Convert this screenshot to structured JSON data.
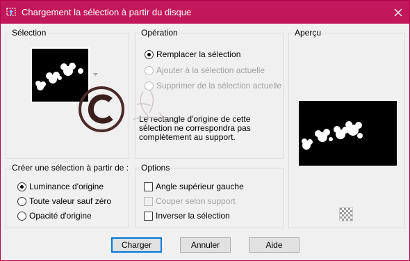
{
  "window": {
    "title": "Chargement la sélection à partir du disque",
    "accent_color": "#c2185b"
  },
  "icons": {
    "title": "selection-load-icon",
    "close": "close-icon",
    "transparency": "checkerboard-icon",
    "logo": "copyright-logo"
  },
  "selection": {
    "label": "Sélection"
  },
  "operation": {
    "label": "Opération",
    "options": [
      {
        "label": "Remplacer la sélection",
        "checked": true,
        "enabled": true
      },
      {
        "label": "Ajouter à la sélection actuelle",
        "checked": false,
        "enabled": false
      },
      {
        "label": "Supprimer de la sélection actuelle",
        "checked": false,
        "enabled": false
      }
    ],
    "note_lines": [
      "Le rectangle d'origine de cette",
      "sélection ne correspondra pas",
      "complètement au support."
    ]
  },
  "preview": {
    "label": "Aperçu"
  },
  "create": {
    "label": "Créer une sélection à partir de :",
    "options": [
      {
        "label": "Luminance d'origine",
        "checked": true
      },
      {
        "label": "Toute valeur sauf zéro",
        "checked": false
      },
      {
        "label": "Opacité d'origine",
        "checked": false
      }
    ]
  },
  "options": {
    "label": "Options",
    "items": [
      {
        "label": "Angle supérieur gauche",
        "checked": false,
        "enabled": true
      },
      {
        "label": "Couper selon support",
        "checked": false,
        "enabled": false
      },
      {
        "label": "Inverser la sélection",
        "checked": false,
        "enabled": true
      }
    ]
  },
  "buttons": {
    "ok": "Charger",
    "cancel": "Annuler",
    "help": "Aide"
  }
}
